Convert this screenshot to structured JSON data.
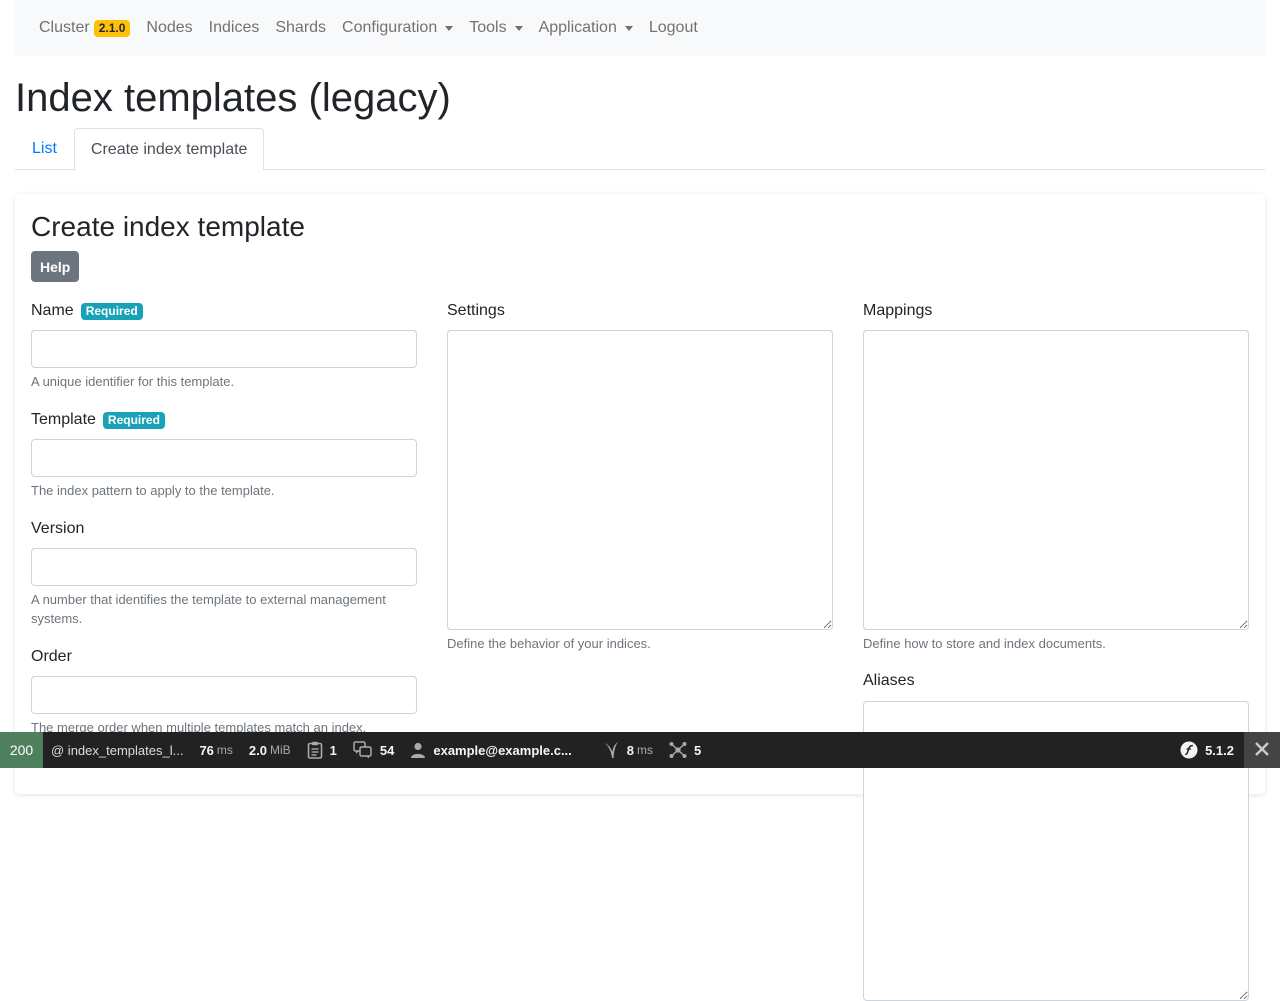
{
  "navbar": {
    "cluster_label": "Cluster",
    "cluster_version": "2.1.0",
    "nodes": "Nodes",
    "indices": "Indices",
    "shards": "Shards",
    "configuration": "Configuration",
    "tools": "Tools",
    "application": "Application",
    "logout": "Logout"
  },
  "page": {
    "title": "Index templates (legacy)",
    "tabs": [
      {
        "label": "List",
        "active": false
      },
      {
        "label": "Create index template",
        "active": true
      }
    ]
  },
  "form": {
    "title": "Create index template",
    "help_label": "Help",
    "required_label": "Required",
    "name": {
      "label": "Name",
      "help": "A unique identifier for this template.",
      "value": ""
    },
    "template": {
      "label": "Template",
      "help": "The index pattern to apply to the template.",
      "value": ""
    },
    "version": {
      "label": "Version",
      "help": "A number that identifies the template to external management systems.",
      "value": ""
    },
    "order": {
      "label": "Order",
      "help": "The merge order when multiple templates match an index.",
      "value": ""
    },
    "settings": {
      "label": "Settings",
      "help": "Define the behavior of your indices.",
      "value": ""
    },
    "mappings": {
      "label": "Mappings",
      "help": "Define how to store and index documents.",
      "value": ""
    },
    "aliases": {
      "label": "Aliases",
      "value": ""
    }
  },
  "toolbar": {
    "status": "200",
    "route": "@ index_templates_l...",
    "time_value": "76",
    "time_unit": "ms",
    "memory_value": "2.0",
    "memory_unit": "MiB",
    "logs_count": "1",
    "translations_count": "54",
    "user": "example@example.c...",
    "twig_value": "8",
    "twig_unit": "ms",
    "cache_count": "5",
    "symfony_version": "5.1.2",
    "colors": {
      "status_bg": "#4f805d",
      "bar_bg": "#222222"
    }
  }
}
